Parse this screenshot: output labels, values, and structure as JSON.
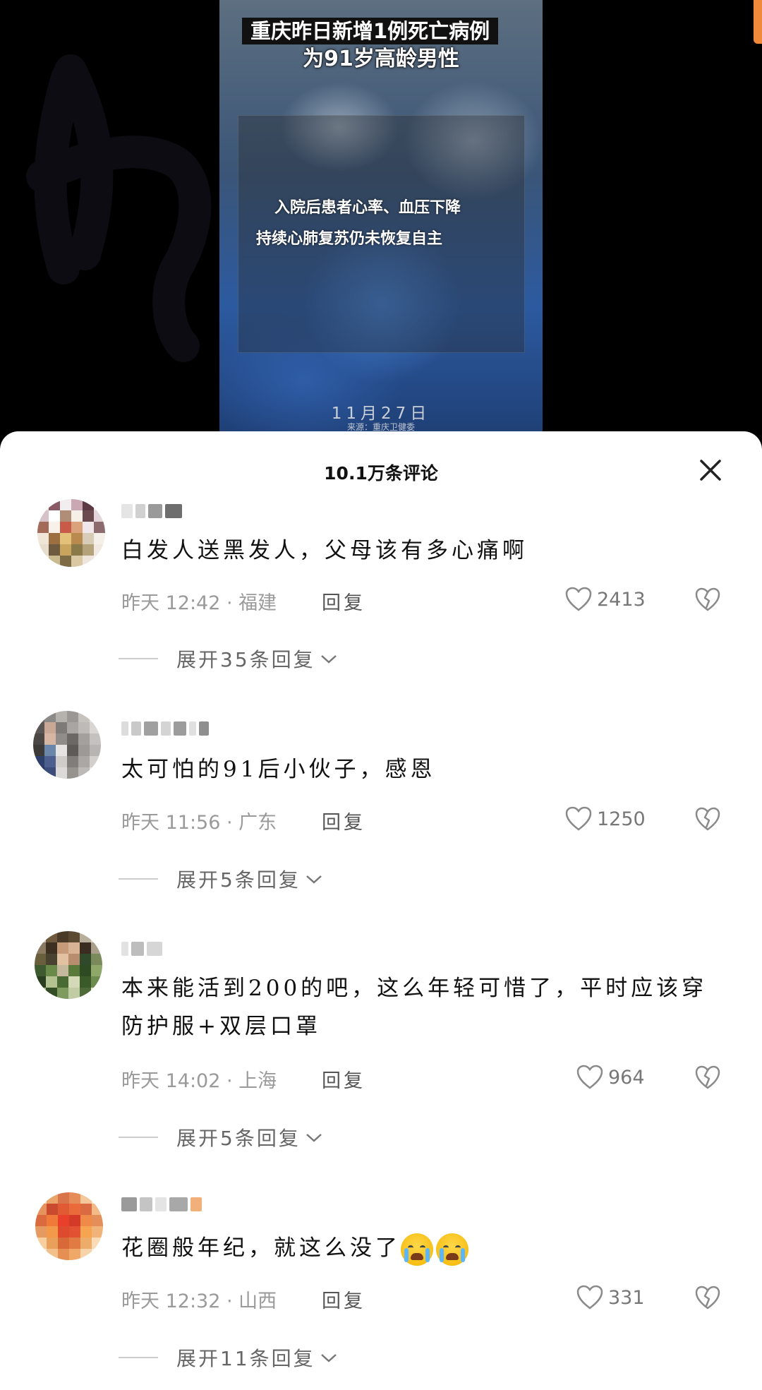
{
  "video": {
    "title_line1": "重庆昨日新增1例死亡病例",
    "title_line2": "为91岁高龄男性",
    "subtitle_line1": "入院后患者心率、血压下降",
    "subtitle_line2": "持续心肺复苏仍未恢复自主",
    "date": "11月27日",
    "source": "来源：重庆卫健委"
  },
  "comments_panel": {
    "count_label": "10.1万条评论",
    "reply_label": "回复",
    "comments": [
      {
        "text": "白发人送黑发人，父母该有多心痛啊",
        "meta": "昨天 12:42 · 福建",
        "likes": "2413",
        "expand_label": "展开35条回复"
      },
      {
        "text": "太可怕的91后小伙子，感恩",
        "meta": "昨天 11:56 · 广东",
        "likes": "1250",
        "expand_label": "展开5条回复"
      },
      {
        "text": "本来能活到200的吧，这么年轻可惜了，平时应该穿防护服+双层口罩",
        "meta": "昨天 14:02 · 上海",
        "likes": "964",
        "expand_label": "展开5条回复"
      },
      {
        "text": "花圈般年纪，就这么没了",
        "emoji": "crying-face",
        "meta": "昨天 12:32 · 山西",
        "likes": "331",
        "expand_label": "展开11条回复"
      }
    ]
  },
  "colors": {
    "accent_orange": "#f08a3a",
    "sheet_background": "#ffffff",
    "meta_gray": "#9a9a9a"
  }
}
